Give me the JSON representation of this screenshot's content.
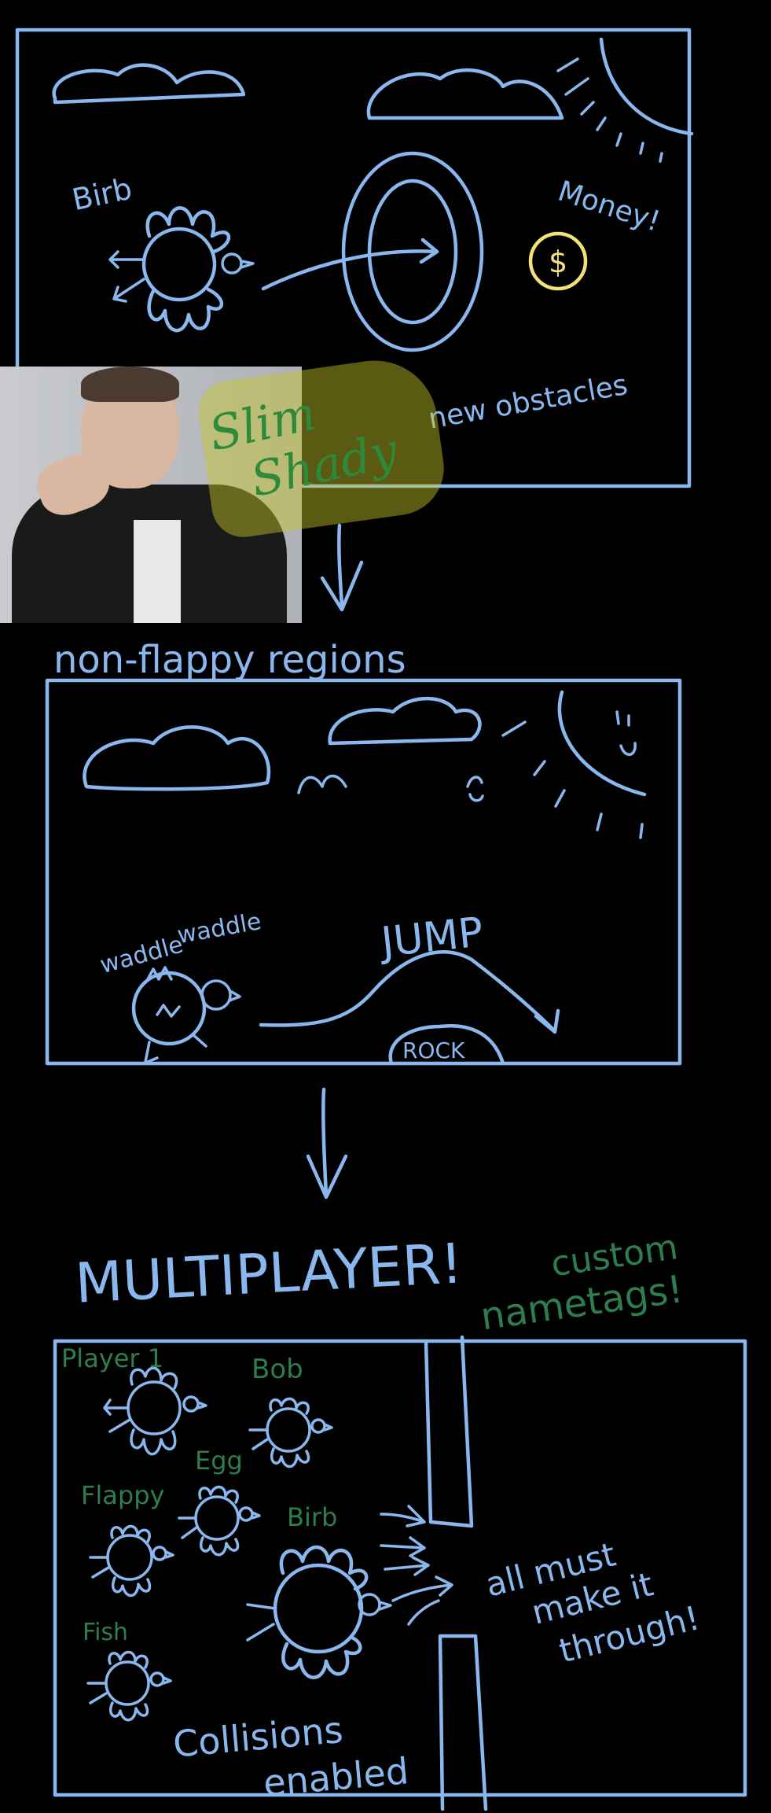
{
  "panel1": {
    "bird_label": "Birb",
    "money_label": "Money!",
    "coin_symbol": "$",
    "obstacles_label": "new obstacles",
    "photo_caption_line1": "Slim",
    "photo_caption_line2": "Shady"
  },
  "panel2": {
    "title": "non-flappy regions",
    "waddle_label_1": "waddle",
    "waddle_label_2": "waddle",
    "jump_label": "JUMP",
    "rock_label": "ROCK"
  },
  "panel3": {
    "title": "MULTIPLAYER!",
    "nametag_note_1": "custom",
    "nametag_note_2": "nametags!",
    "players": [
      "Player 1",
      "Bob",
      "Egg",
      "Flappy",
      "Birb",
      "Fish"
    ],
    "note_line1": "all must",
    "note_line2": "make it",
    "note_line3": "through!",
    "collisions_1": "Collisions",
    "collisions_2": "enabled"
  },
  "colors": {
    "stroke": "#8ab8ee",
    "green": "#2e7d4f",
    "coin": "#f2e27a",
    "highlight": "#c8c828"
  }
}
